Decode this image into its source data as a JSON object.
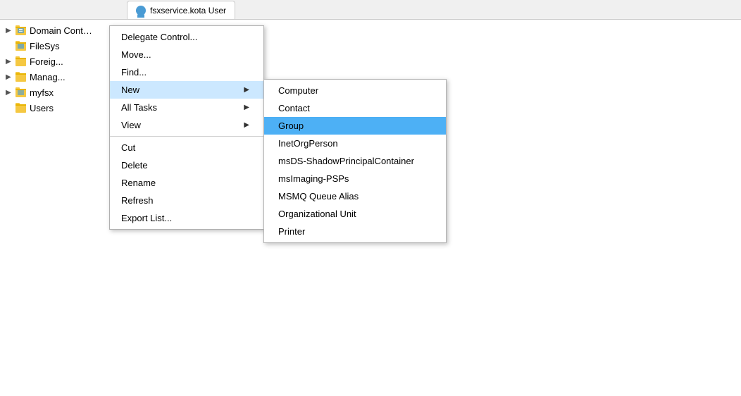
{
  "background": {
    "color": "#ffffff"
  },
  "tab": {
    "label": "fsxservice.kota   User"
  },
  "treeItems": [
    {
      "id": "domain-controllers",
      "label": "Domain Controllers",
      "hasArrow": true,
      "iconType": "folder-special"
    },
    {
      "id": "filesys",
      "label": "FileSys",
      "hasArrow": false,
      "iconType": "folder-special"
    },
    {
      "id": "foreign",
      "label": "Foreig...",
      "hasArrow": true,
      "iconType": "folder"
    },
    {
      "id": "manage",
      "label": "Manag...",
      "hasArrow": true,
      "iconType": "folder"
    },
    {
      "id": "myfsx",
      "label": "myfsx",
      "hasArrow": true,
      "iconType": "folder-special"
    },
    {
      "id": "users",
      "label": "Users",
      "hasArrow": false,
      "iconType": "folder"
    }
  ],
  "contextMenu": {
    "items": [
      {
        "id": "delegate-control",
        "label": "Delegate Control...",
        "hasArrow": false,
        "hasSeparator": false
      },
      {
        "id": "move",
        "label": "Move...",
        "hasArrow": false,
        "hasSeparator": false
      },
      {
        "id": "find",
        "label": "Find...",
        "hasArrow": false,
        "hasSeparator": false
      },
      {
        "id": "new",
        "label": "New",
        "hasArrow": true,
        "isActive": true,
        "hasSeparator": false
      },
      {
        "id": "all-tasks",
        "label": "All Tasks",
        "hasArrow": true,
        "hasSeparator": false
      },
      {
        "id": "view",
        "label": "View",
        "hasArrow": true,
        "hasSeparator": true
      },
      {
        "id": "cut",
        "label": "Cut",
        "hasArrow": false,
        "hasSeparator": false
      },
      {
        "id": "delete",
        "label": "Delete",
        "hasArrow": false,
        "hasSeparator": false
      },
      {
        "id": "rename",
        "label": "Rename",
        "hasArrow": false,
        "hasSeparator": false
      },
      {
        "id": "refresh",
        "label": "Refresh",
        "hasArrow": false,
        "hasSeparator": false
      },
      {
        "id": "export-list",
        "label": "Export List...",
        "hasArrow": false,
        "hasSeparator": false
      }
    ]
  },
  "submenu": {
    "items": [
      {
        "id": "computer",
        "label": "Computer",
        "isActive": false
      },
      {
        "id": "contact",
        "label": "Contact",
        "isActive": false
      },
      {
        "id": "group",
        "label": "Group",
        "isActive": true
      },
      {
        "id": "inetorgperson",
        "label": "InetOrgPerson",
        "isActive": false
      },
      {
        "id": "msds-shadow",
        "label": "msDS-ShadowPrincipalContainer",
        "isActive": false
      },
      {
        "id": "mslimaging",
        "label": "msImaging-PSPs",
        "isActive": false
      },
      {
        "id": "msmq",
        "label": "MSMQ Queue Alias",
        "isActive": false
      },
      {
        "id": "ou",
        "label": "Organizational Unit",
        "isActive": false
      },
      {
        "id": "printer",
        "label": "Printer",
        "isActive": false
      }
    ]
  }
}
